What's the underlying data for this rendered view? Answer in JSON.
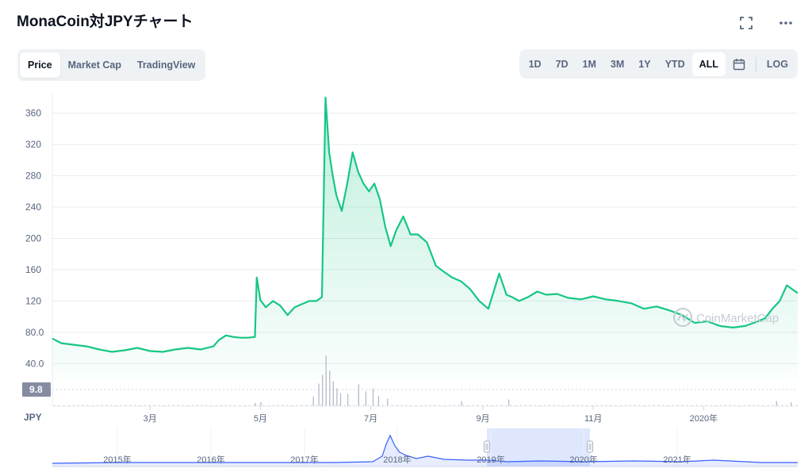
{
  "header": {
    "title": "MonaCoin対JPYチャート",
    "icons": [
      "fullscreen-icon",
      "more-icon"
    ]
  },
  "tabs_left": [
    {
      "label": "Price",
      "active": true
    },
    {
      "label": "Market Cap",
      "active": false
    },
    {
      "label": "TradingView",
      "active": false
    }
  ],
  "tabs_right": [
    {
      "label": "1D",
      "active": false
    },
    {
      "label": "7D",
      "active": false
    },
    {
      "label": "1M",
      "active": false
    },
    {
      "label": "3M",
      "active": false
    },
    {
      "label": "1Y",
      "active": false
    },
    {
      "label": "YTD",
      "active": false
    },
    {
      "label": "ALL",
      "active": true
    }
  ],
  "log_label": "LOG",
  "watermark": "CoinMarketCap",
  "colors": {
    "line": "#16c784",
    "fill": "#16c784",
    "grid": "#e8ecf1",
    "volume": "#b8bfcc",
    "navigator_line": "#3861fb",
    "navigator_selection": "#dfe7ff",
    "volume_label_bg": "#858ca2"
  },
  "chart_data": {
    "type": "line",
    "title": "MonaCoin対JPYチャート",
    "xlabel": "",
    "ylabel": "JPY",
    "ylim": [
      20,
      385
    ],
    "yticks": [
      "40.0",
      "80.0",
      "120",
      "160",
      "200",
      "240",
      "280",
      "320",
      "360"
    ],
    "ytick_values": [
      40,
      80,
      120,
      160,
      200,
      240,
      280,
      320,
      360
    ],
    "xlim": [
      "2019-01-06",
      "2020-02-22"
    ],
    "xticks": [
      {
        "label": "3月",
        "date": "2019-03-01"
      },
      {
        "label": "5月",
        "date": "2019-05-01"
      },
      {
        "label": "7月",
        "date": "2019-07-01"
      },
      {
        "label": "9月",
        "date": "2019-09-01"
      },
      {
        "label": "11月",
        "date": "2019-11-01"
      },
      {
        "label": "2020年",
        "date": "2020-01-01"
      }
    ],
    "volume_label": "9.8",
    "currency_label": "JPY",
    "series": [
      {
        "name": "Price",
        "x": [
          "2019-01-06",
          "2019-01-11",
          "2019-01-18",
          "2019-01-25",
          "2019-02-01",
          "2019-02-08",
          "2019-02-15",
          "2019-02-22",
          "2019-03-01",
          "2019-03-08",
          "2019-03-15",
          "2019-03-22",
          "2019-03-29",
          "2019-04-05",
          "2019-04-08",
          "2019-04-12",
          "2019-04-16",
          "2019-04-20",
          "2019-04-24",
          "2019-04-28",
          "2019-04-29",
          "2019-05-01",
          "2019-05-04",
          "2019-05-08",
          "2019-05-12",
          "2019-05-16",
          "2019-05-20",
          "2019-05-24",
          "2019-05-28",
          "2019-06-01",
          "2019-06-04",
          "2019-06-06",
          "2019-06-08",
          "2019-06-10",
          "2019-06-12",
          "2019-06-15",
          "2019-06-18",
          "2019-06-21",
          "2019-06-24",
          "2019-06-27",
          "2019-06-30",
          "2019-07-03",
          "2019-07-06",
          "2019-07-09",
          "2019-07-12",
          "2019-07-15",
          "2019-07-19",
          "2019-07-23",
          "2019-07-27",
          "2019-08-01",
          "2019-08-06",
          "2019-08-10",
          "2019-08-15",
          "2019-08-20",
          "2019-08-25",
          "2019-08-30",
          "2019-09-04",
          "2019-09-10",
          "2019-09-14",
          "2019-09-17",
          "2019-09-21",
          "2019-09-26",
          "2019-10-01",
          "2019-10-06",
          "2019-10-12",
          "2019-10-18",
          "2019-10-25",
          "2019-11-01",
          "2019-11-08",
          "2019-11-15",
          "2019-11-22",
          "2019-11-29",
          "2019-12-06",
          "2019-12-13",
          "2019-12-20",
          "2019-12-27",
          "2020-01-03",
          "2020-01-10",
          "2020-01-17",
          "2020-01-24",
          "2020-01-31",
          "2020-02-04",
          "2020-02-08",
          "2020-02-12",
          "2020-02-16",
          "2020-02-22"
        ],
        "values": [
          72,
          66,
          64,
          62,
          58,
          55,
          57,
          60,
          56,
          55,
          58,
          60,
          58,
          62,
          70,
          76,
          74,
          73,
          73,
          74,
          150,
          121,
          112,
          120,
          114,
          102,
          112,
          116,
          120,
          120,
          125,
          380,
          310,
          280,
          255,
          235,
          270,
          310,
          285,
          270,
          260,
          270,
          250,
          215,
          190,
          210,
          228,
          205,
          205,
          195,
          165,
          158,
          150,
          145,
          135,
          120,
          110,
          155,
          128,
          125,
          120,
          125,
          132,
          128,
          129,
          124,
          122,
          126,
          122,
          120,
          117,
          110,
          113,
          108,
          102,
          92,
          94,
          88,
          86,
          88,
          94,
          98,
          110,
          120,
          140,
          130
        ]
      }
    ],
    "volume": {
      "name": "Volume",
      "spike_dates": [
        "2019-04-28",
        "2019-05-01",
        "2019-05-30",
        "2019-06-02",
        "2019-06-04",
        "2019-06-06",
        "2019-06-08",
        "2019-06-10",
        "2019-06-12",
        "2019-06-14",
        "2019-06-18",
        "2019-06-24",
        "2019-06-28",
        "2019-07-02",
        "2019-07-05",
        "2019-07-10",
        "2019-08-20",
        "2019-09-15",
        "2020-02-10",
        "2020-02-18"
      ],
      "spike_values": [
        2.1,
        2.6,
        6.1,
        14.2,
        19.8,
        31.9,
        22.4,
        15.8,
        11.3,
        8.2,
        7.6,
        13.8,
        9.4,
        11.1,
        6.4,
        4.7,
        3.1,
        4.2,
        3.2,
        2.6
      ]
    },
    "navigator": {
      "ticks": [
        "2015年",
        "2016年",
        "2017年",
        "2018年",
        "2019年",
        "2020年",
        "2021年"
      ]
    }
  }
}
